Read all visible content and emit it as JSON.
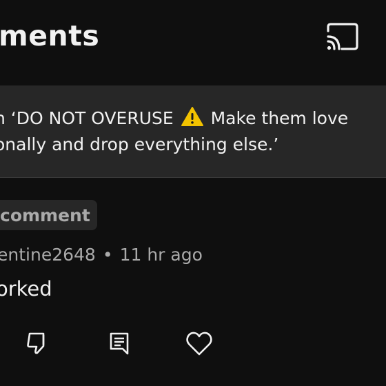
{
  "header": {
    "title": "ments",
    "cast_icon": "cast-icon"
  },
  "banner": {
    "line1_before": "n ‘DO NOT OVERUSE ",
    "warning_icon": "warning-icon",
    "line1_after": " Make them love",
    "line2": "onally and drop everything else.’"
  },
  "comment": {
    "pinned_label": "comment",
    "author": "entine2648",
    "separator": "•",
    "time": "11 hr ago",
    "text": "orked"
  },
  "actions": {
    "icons": [
      "dislike-icon",
      "reply-icon",
      "heart-icon"
    ]
  },
  "colors": {
    "background": "#0f0f0f",
    "banner": "#272727",
    "primary_text": "#f1f1f1",
    "secondary_text": "#aaaaaa",
    "warning": "#f2c200"
  }
}
